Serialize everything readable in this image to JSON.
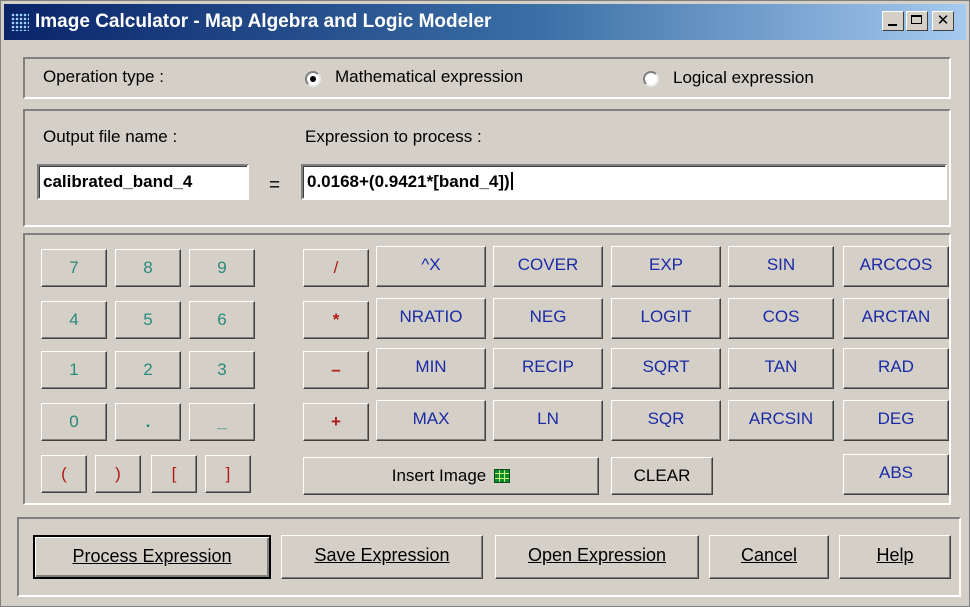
{
  "window": {
    "title": "Image Calculator - Map  Algebra and Logic Modeler"
  },
  "operation": {
    "label": "Operation type :",
    "options": [
      {
        "label": "Mathematical expression",
        "selected": true
      },
      {
        "label": "Logical expression",
        "selected": false
      }
    ]
  },
  "output": {
    "label": "Output file name :",
    "value": "calibrated_band_4",
    "equals": "="
  },
  "expression": {
    "label": "Expression to process :",
    "value": "0.0168+(0.9421*[band_4])"
  },
  "keypad": {
    "row1": [
      "7",
      "8",
      "9"
    ],
    "row2": [
      "4",
      "5",
      "6"
    ],
    "row3": [
      "1",
      "2",
      "3"
    ],
    "row4": [
      "0",
      ".",
      "_"
    ],
    "brackets": [
      "(",
      ")",
      "[",
      "]"
    ]
  },
  "operators": [
    "/",
    "*",
    "–",
    "+"
  ],
  "functions": {
    "col1": [
      "^X",
      "NRATIO",
      "MIN",
      "MAX"
    ],
    "col2": [
      "COVER",
      "NEG",
      "RECIP",
      "LN"
    ],
    "col3": [
      "EXP",
      "LOGIT",
      "SQRT",
      "SQR"
    ],
    "col4": [
      "SIN",
      "COS",
      "TAN",
      "ARCSIN"
    ],
    "col5": [
      "ARCCOS",
      "ARCTAN",
      "RAD",
      "DEG",
      "ABS"
    ]
  },
  "insert_image_label": "Insert Image",
  "clear_label": "CLEAR",
  "actions": {
    "process": "Process Expression",
    "save": "Save Expression",
    "open": "Open Expression",
    "cancel": "Cancel",
    "help": "Help"
  },
  "colors": {
    "digits": "#2a8a7a",
    "operators": "#b01818",
    "functions": "#1c2aa6",
    "title_bar": "#0a246a"
  },
  "icons": [
    "app-grid-icon",
    "minimize-icon",
    "maximize-icon",
    "close-icon",
    "image-grid-icon"
  ]
}
